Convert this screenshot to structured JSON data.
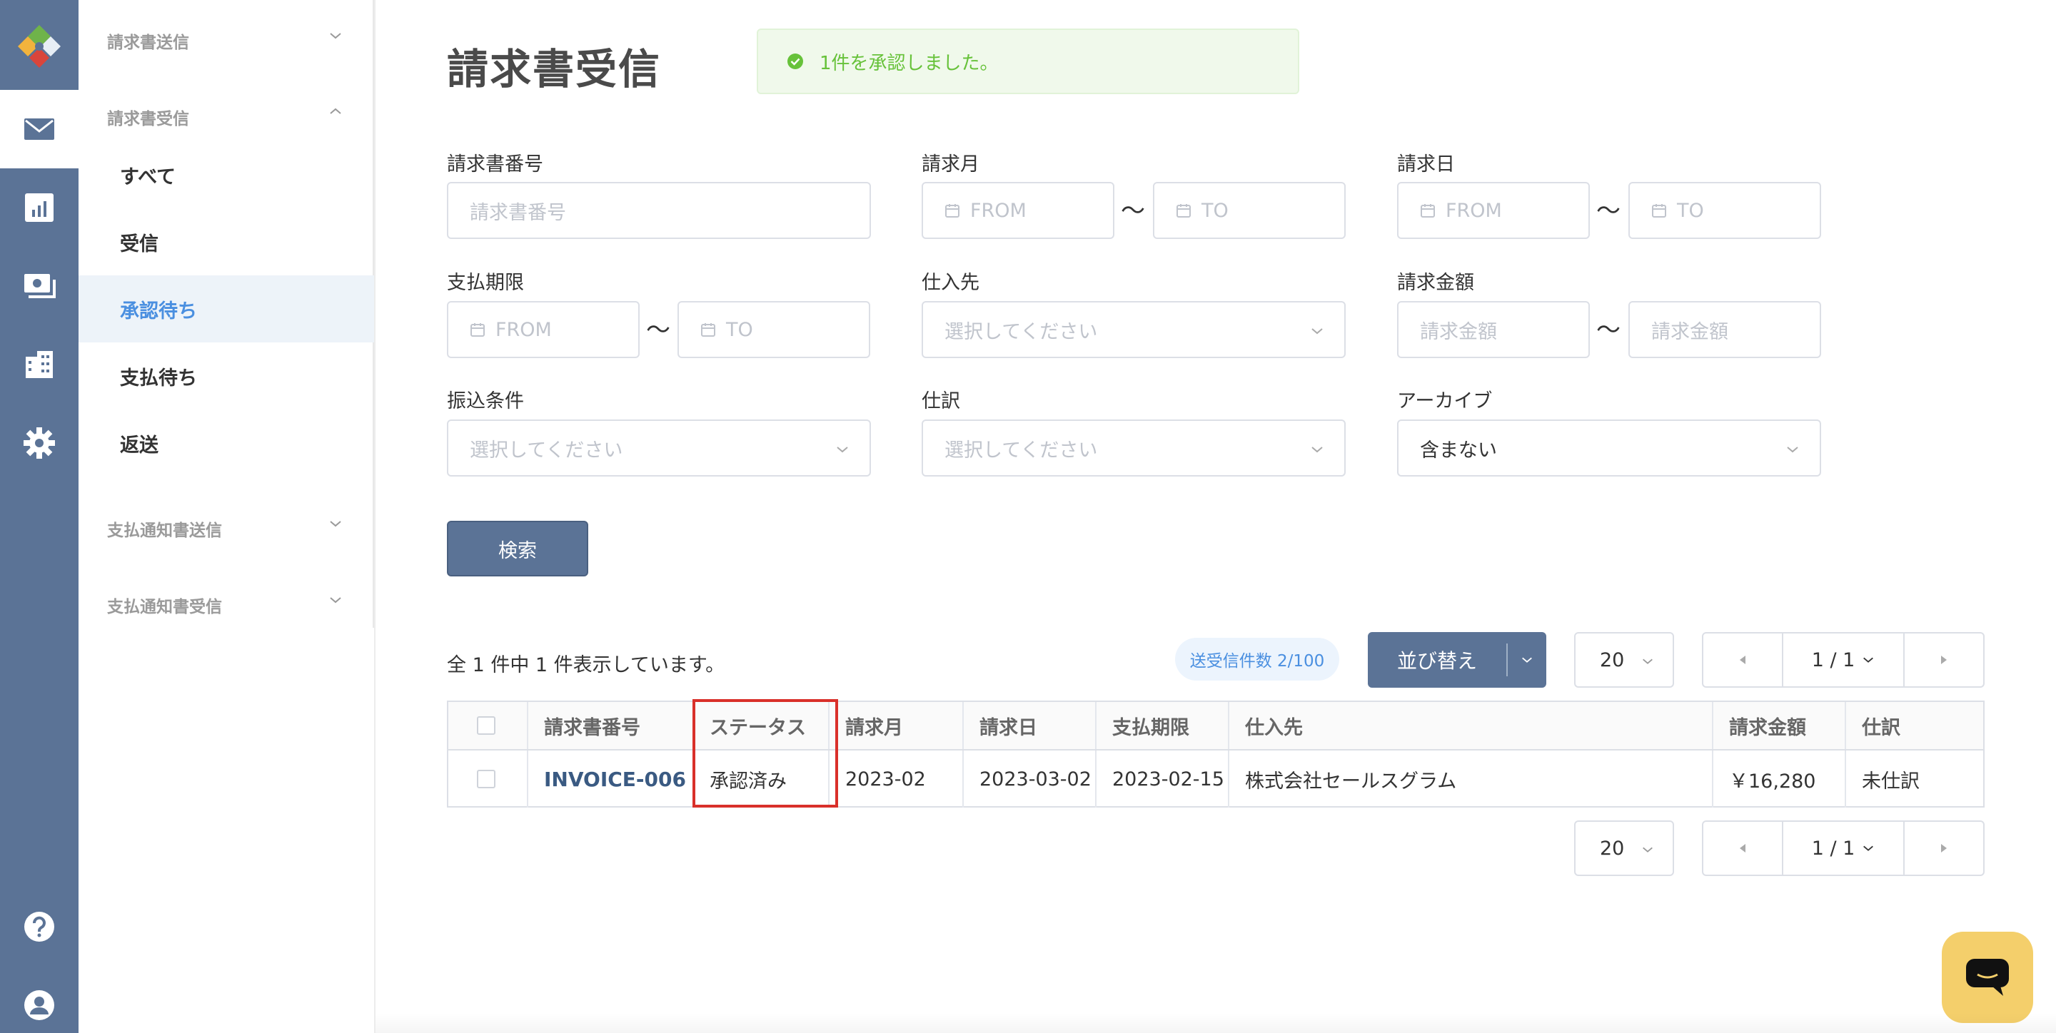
{
  "sidebar": {
    "group_send": "請求書送信",
    "group_receive": "請求書受信",
    "items": [
      {
        "label": "すべて"
      },
      {
        "label": "受信"
      },
      {
        "label": "承認待ち"
      },
      {
        "label": "支払待ち"
      },
      {
        "label": "返送"
      }
    ],
    "group_payment_send": "支払通知書送信",
    "group_payment_receive": "支払通知書受信"
  },
  "page": {
    "title": "請求書受信",
    "toast": "1件を承認しました。"
  },
  "filters": {
    "invoice_no_label": "請求書番号",
    "invoice_no_placeholder": "請求書番号",
    "billing_month_label": "請求月",
    "billing_date_label": "請求日",
    "due_label": "支払期限",
    "supplier_label": "仕入先",
    "amount_label": "請求金額",
    "amount_placeholder": "請求金額",
    "transfer_label": "振込条件",
    "journal_label": "仕訳",
    "archive_label": "アーカイブ",
    "archive_value": "含まない",
    "select_placeholder": "選択してください",
    "from": "FROM",
    "to": "TO",
    "tilde": "〜",
    "search_button": "検索"
  },
  "results": {
    "count_text": "全 1 件中 1 件表示しています。",
    "quota": "送受信件数 2/100",
    "sort_label": "並び替え",
    "per_page": "20",
    "page_indicator": "1 / 1"
  },
  "table": {
    "headers": [
      "請求書番号",
      "ステータス",
      "請求月",
      "請求日",
      "支払期限",
      "仕入先",
      "請求金額",
      "仕訳"
    ],
    "rows": [
      [
        "INVOICE-006",
        "承認済み",
        "2023-02",
        "2023-03-02",
        "2023-02-15",
        "株式会社セールスグラム",
        "￥16,280",
        "未仕訳"
      ]
    ]
  },
  "colors": {
    "rail": "#5b7396",
    "accent": "#4a8fe0",
    "success": "#67c23a",
    "highlight": "#d9302a",
    "chat": "#f4cf6b"
  }
}
